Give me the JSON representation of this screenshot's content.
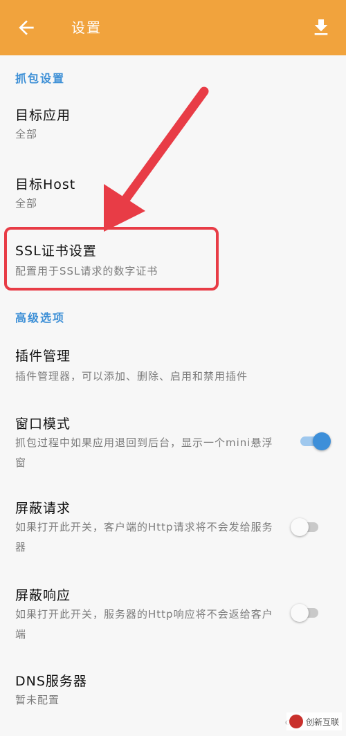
{
  "appbar": {
    "title": "设置",
    "back_icon": "arrow-left-icon",
    "download_icon": "download-icon",
    "color": "#f1a33d"
  },
  "sections": {
    "capture": "抓包设置",
    "advanced": "高级选项"
  },
  "items": {
    "target_app": {
      "title": "目标应用",
      "subtitle": "全部"
    },
    "target_host": {
      "title": "目标Host",
      "subtitle": "全部"
    },
    "ssl": {
      "title": "SSL证书设置",
      "subtitle": "配置用于SSL请求的数字证书"
    },
    "plugins": {
      "title": "插件管理",
      "subtitle": "插件管理器，可以添加、删除、启用和禁用插件"
    },
    "window_mode": {
      "title": "窗口模式",
      "subtitle": "抓包过程中如果应用退回到后台，显示一个mini悬浮窗",
      "enabled": true
    },
    "block_request": {
      "title": "屏蔽请求",
      "subtitle": "如果打开此开关，客户端的Http请求将不会发给服务器",
      "enabled": false
    },
    "block_response": {
      "title": "屏蔽响应",
      "subtitle": "如果打开此开关，服务器的Http响应将不会返给客户端",
      "enabled": false
    },
    "dns": {
      "title": "DNS服务器",
      "subtitle": "暂未配置"
    }
  },
  "annotation": {
    "highlight_color": "#e83c46"
  },
  "watermark": {
    "text": "创新互联",
    "corner": "C"
  }
}
